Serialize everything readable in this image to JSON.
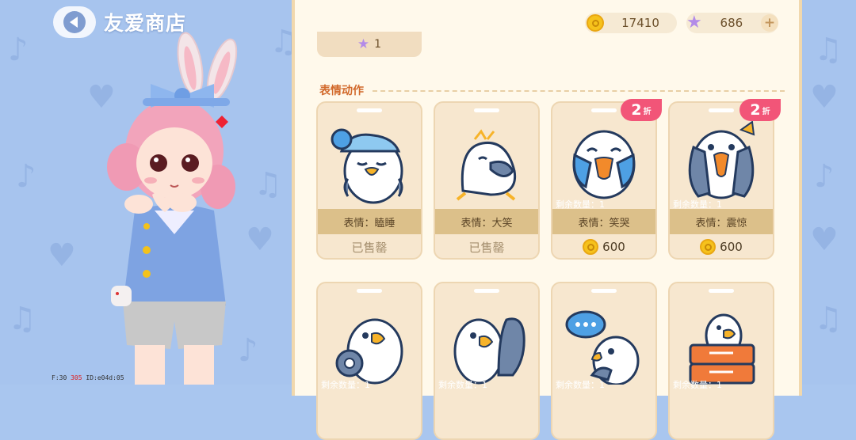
{
  "header": {
    "back_icon": "back-arrow-icon",
    "title": "友爱商店"
  },
  "debug": {
    "a": "F:30",
    "b": "305",
    "c": "ID:e04d:05"
  },
  "currency": {
    "coins": "17410",
    "stars": "686",
    "plus": "+"
  },
  "previous_row": {
    "star_count": "1"
  },
  "section": {
    "title": "表情动作"
  },
  "cards": [
    {
      "label": "表情：瞌睡",
      "status": "已售罄",
      "remain": "",
      "badge": ""
    },
    {
      "label": "表情：大笑",
      "status": "已售罄",
      "remain": "",
      "badge": ""
    },
    {
      "label": "表情：笑哭",
      "price": "600",
      "remain": "剩余数量：1",
      "badge": "2",
      "badge_suffix": "折"
    },
    {
      "label": "表情：震惊",
      "price": "600",
      "remain": "剩余数量：1",
      "badge": "2",
      "badge_suffix": "折"
    },
    {
      "remain": "剩余数量：1"
    },
    {
      "remain": "剩余数量：1"
    },
    {
      "remain": "剩余数量：1"
    },
    {
      "remain": "剩余数量：1"
    }
  ],
  "colors": {
    "accent": "#d26a2c",
    "badge": "#f25578",
    "panel": "#fff9eb",
    "coin": "#f6c21c",
    "star": "#b38be8"
  }
}
